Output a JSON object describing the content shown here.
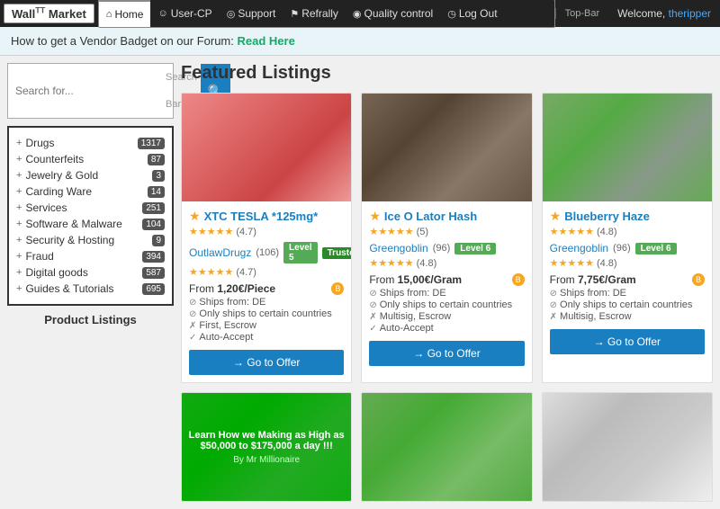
{
  "logo": {
    "text": "Wall",
    "sup": "TT",
    "text2": "Market"
  },
  "topbar": {
    "label": "Top-Bar",
    "welcome": "Welcome,",
    "username": "theripper",
    "nav": [
      {
        "id": "home",
        "icon": "⌂",
        "label": "Home",
        "active": true
      },
      {
        "id": "user-cp",
        "icon": "☺",
        "label": "User-CP",
        "active": false
      },
      {
        "id": "support",
        "icon": "◎",
        "label": "Support",
        "active": false
      },
      {
        "id": "refrally",
        "icon": "⚑",
        "label": "Refrally",
        "active": false
      },
      {
        "id": "quality-control",
        "icon": "◉",
        "label": "Quality control",
        "active": false
      },
      {
        "id": "log-out",
        "icon": "◷",
        "label": "Log Out",
        "active": false
      }
    ]
  },
  "banner": {
    "text": "How to get a Vendor Badget on our Forum:",
    "link_text": "Read Here"
  },
  "search": {
    "placeholder": "Search for..."
  },
  "categories": [
    {
      "name": "Drugs",
      "count": "1317",
      "badge_type": "dark"
    },
    {
      "name": "Counterfeits",
      "count": "87",
      "badge_type": "dark"
    },
    {
      "name": "Jewelry & Gold",
      "count": "3",
      "badge_type": "dark"
    },
    {
      "name": "Carding Ware",
      "count": "14",
      "badge_type": "dark"
    },
    {
      "name": "Services",
      "count": "251",
      "badge_type": "dark"
    },
    {
      "name": "Software & Malware",
      "count": "104",
      "badge_type": "dark"
    },
    {
      "name": "Security & Hosting",
      "count": "9",
      "badge_type": "dark"
    },
    {
      "name": "Fraud",
      "count": "394",
      "badge_type": "dark"
    },
    {
      "name": "Digital goods",
      "count": "587",
      "badge_type": "dark"
    },
    {
      "name": "Guides & Tutorials",
      "count": "695",
      "badge_type": "dark"
    }
  ],
  "sidebar_title": "Product Listings",
  "featured_title": "Featured Listings",
  "listings": [
    {
      "id": 1,
      "img_type": "pink",
      "title": "XTC TESLA *125mg*",
      "stars": "★★★★★",
      "rating": "(4.7)",
      "vendor": "OutlawDrugz",
      "vendor_count": "(106)",
      "vendor_stars": "★★★★★",
      "vendor_rating": "(4.7)",
      "level": "Level 5",
      "trusted": "Trusted",
      "price": "From 1,20€/Piece",
      "ships_from": "Ships from: DE",
      "details": [
        "Only ships to certain countries",
        "First, Escrow",
        "Auto-Accept"
      ],
      "detail_icons": [
        "⊘",
        "✗",
        "✓"
      ],
      "btn_label": "→ Go to Offer"
    },
    {
      "id": 2,
      "img_type": "brown",
      "title": "Ice O Lator Hash",
      "stars": "★★★★★",
      "rating": "(5)",
      "vendor": "Greengoblin",
      "vendor_count": "(96)",
      "vendor_stars": "★★★★★",
      "vendor_rating": "(4.8)",
      "level": "Level 6",
      "trusted": "",
      "price": "From 15,00€/Gram",
      "ships_from": "Ships from: DE",
      "details": [
        "Only ships to certain countries",
        "Multisig, Escrow",
        "Auto-Accept"
      ],
      "detail_icons": [
        "⊘",
        "✗",
        "✓"
      ],
      "btn_label": "→ Go to Offer"
    },
    {
      "id": 3,
      "img_type": "green",
      "title": "Blueberry Haze",
      "stars": "★★★★★",
      "rating": "(4.8)",
      "vendor": "Greengoblin",
      "vendor_count": "(96)",
      "vendor_stars": "★★★★★",
      "vendor_rating": "(4.8)",
      "level": "Level 6",
      "trusted": "",
      "price": "From 7,75€/Gram",
      "ships_from": "Ships from: DE",
      "details": [
        "Only ships to certain countries",
        "Multisig, Escrow"
      ],
      "detail_icons": [
        "⊘",
        "✗"
      ],
      "btn_label": "→ Go to Offer"
    }
  ],
  "bottom_listings_img_types": [
    "ad",
    "weed2",
    "white"
  ]
}
